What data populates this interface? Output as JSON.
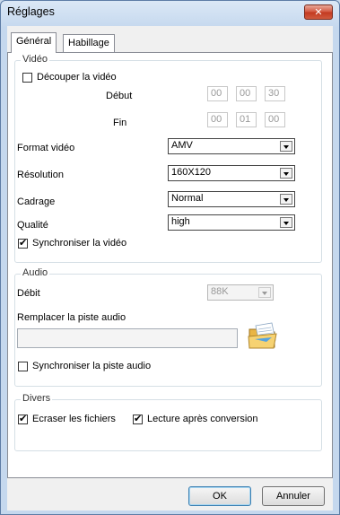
{
  "window": {
    "title": "Réglages",
    "close_label": "✕"
  },
  "tabs": [
    {
      "label": "Général",
      "active": true
    },
    {
      "label": "Habillage",
      "active": false
    }
  ],
  "video": {
    "legend": "Vidéo",
    "cut": {
      "label": "Découper la vidéo",
      "checked": false
    },
    "start": {
      "label": "Début",
      "h": "00",
      "m": "00",
      "s": "30"
    },
    "end": {
      "label": "Fin",
      "h": "00",
      "m": "01",
      "s": "00"
    },
    "format": {
      "label": "Format vidéo",
      "value": "AMV"
    },
    "resolution": {
      "label": "Résolution",
      "value": "160X120"
    },
    "framing": {
      "label": "Cadrage",
      "value": "Normal"
    },
    "quality": {
      "label": "Qualité",
      "value": "high"
    },
    "sync": {
      "label": "Synchroniser la vidéo",
      "checked": true
    }
  },
  "audio": {
    "legend": "Audio",
    "bitrate": {
      "label": "Débit",
      "value": "88K"
    },
    "replace_label": "Remplacer la piste audio",
    "replace_value": "",
    "sync": {
      "label": "Synchroniser la piste audio",
      "checked": false
    }
  },
  "misc": {
    "legend": "Divers",
    "overwrite": {
      "label": "Ecraser les fichiers",
      "checked": true
    },
    "play_after": {
      "label": "Lecture après conversion",
      "checked": true
    }
  },
  "buttons": {
    "ok": "OK",
    "cancel": "Annuler"
  },
  "check_mark": "✔"
}
